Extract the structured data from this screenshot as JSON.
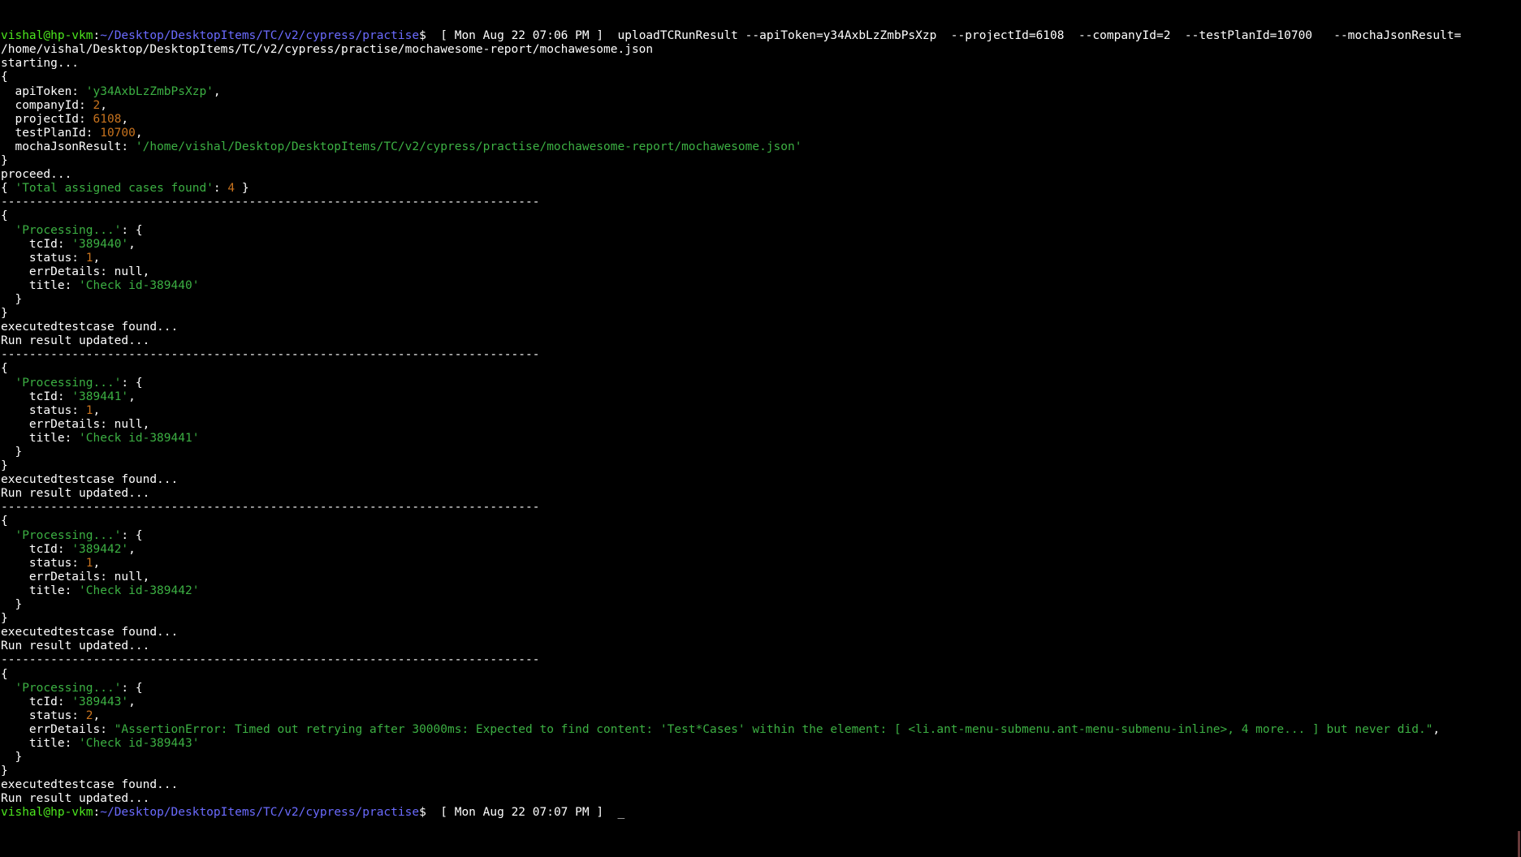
{
  "window": {
    "app": "Terminal",
    "colors": {
      "background": "#000000",
      "text": "#ffffff",
      "prompt_user": "#4ce61e",
      "prompt_path": "#6b6bff",
      "string": "#3cb043",
      "number": "#c8731e"
    }
  },
  "lines": [
    [
      {
        "t": "vishal@hp-vkm",
        "c": "green"
      },
      {
        "t": ":",
        "c": "white"
      },
      {
        "t": "~/Desktop/DesktopItems/TC/v2/cypress/practise",
        "c": "blue"
      },
      {
        "t": "$  [ Mon Aug 22 07:06 PM ]  uploadTCRunResult --apiToken=y34AxbLzZmbPsXzp  --projectId=6108  --companyId=2  --testPlanId=10700   --mochaJsonResult=",
        "c": "white"
      }
    ],
    [
      {
        "t": "/home/vishal/Desktop/DesktopItems/TC/v2/cypress/practise/mochawesome-report/mochawesome.json",
        "c": "white"
      }
    ],
    [
      {
        "t": "starting...",
        "c": "white"
      }
    ],
    [
      {
        "t": "{",
        "c": "white"
      }
    ],
    [
      {
        "t": "  apiToken: ",
        "c": "white"
      },
      {
        "t": "'y34AxbLzZmbPsXzp'",
        "c": "str"
      },
      {
        "t": ",",
        "c": "white"
      }
    ],
    [
      {
        "t": "  companyId: ",
        "c": "white"
      },
      {
        "t": "2",
        "c": "num"
      },
      {
        "t": ",",
        "c": "white"
      }
    ],
    [
      {
        "t": "  projectId: ",
        "c": "white"
      },
      {
        "t": "6108",
        "c": "num"
      },
      {
        "t": ",",
        "c": "white"
      }
    ],
    [
      {
        "t": "  testPlanId: ",
        "c": "white"
      },
      {
        "t": "10700",
        "c": "num"
      },
      {
        "t": ",",
        "c": "white"
      }
    ],
    [
      {
        "t": "  mochaJsonResult: ",
        "c": "white"
      },
      {
        "t": "'/home/vishal/Desktop/DesktopItems/TC/v2/cypress/practise/mochawesome-report/mochawesome.json'",
        "c": "str"
      }
    ],
    [
      {
        "t": "}",
        "c": "white"
      }
    ],
    [
      {
        "t": "proceed...",
        "c": "white"
      }
    ],
    [
      {
        "t": "{ ",
        "c": "white"
      },
      {
        "t": "'Total assigned cases found'",
        "c": "str"
      },
      {
        "t": ": ",
        "c": "white"
      },
      {
        "t": "4",
        "c": "num"
      },
      {
        "t": " }",
        "c": "white"
      }
    ],
    [
      {
        "t": "----------------------------------------------------------------------------",
        "c": "white"
      }
    ],
    [
      {
        "t": "{",
        "c": "white"
      }
    ],
    [
      {
        "t": "  ",
        "c": "white"
      },
      {
        "t": "'Processing...'",
        "c": "str"
      },
      {
        "t": ": {",
        "c": "white"
      }
    ],
    [
      {
        "t": "    tcId: ",
        "c": "white"
      },
      {
        "t": "'389440'",
        "c": "str"
      },
      {
        "t": ",",
        "c": "white"
      }
    ],
    [
      {
        "t": "    status: ",
        "c": "white"
      },
      {
        "t": "1",
        "c": "num"
      },
      {
        "t": ",",
        "c": "white"
      }
    ],
    [
      {
        "t": "    errDetails: null,",
        "c": "white"
      }
    ],
    [
      {
        "t": "    title: ",
        "c": "white"
      },
      {
        "t": "'Check id-389440'",
        "c": "str"
      }
    ],
    [
      {
        "t": "  }",
        "c": "white"
      }
    ],
    [
      {
        "t": "}",
        "c": "white"
      }
    ],
    [
      {
        "t": "executedtestcase found...",
        "c": "white"
      }
    ],
    [
      {
        "t": "Run result updated...",
        "c": "white"
      }
    ],
    [
      {
        "t": "----------------------------------------------------------------------------",
        "c": "white"
      }
    ],
    [
      {
        "t": "{",
        "c": "white"
      }
    ],
    [
      {
        "t": "  ",
        "c": "white"
      },
      {
        "t": "'Processing...'",
        "c": "str"
      },
      {
        "t": ": {",
        "c": "white"
      }
    ],
    [
      {
        "t": "    tcId: ",
        "c": "white"
      },
      {
        "t": "'389441'",
        "c": "str"
      },
      {
        "t": ",",
        "c": "white"
      }
    ],
    [
      {
        "t": "    status: ",
        "c": "white"
      },
      {
        "t": "1",
        "c": "num"
      },
      {
        "t": ",",
        "c": "white"
      }
    ],
    [
      {
        "t": "    errDetails: null,",
        "c": "white"
      }
    ],
    [
      {
        "t": "    title: ",
        "c": "white"
      },
      {
        "t": "'Check id-389441'",
        "c": "str"
      }
    ],
    [
      {
        "t": "  }",
        "c": "white"
      }
    ],
    [
      {
        "t": "}",
        "c": "white"
      }
    ],
    [
      {
        "t": "executedtestcase found...",
        "c": "white"
      }
    ],
    [
      {
        "t": "Run result updated...",
        "c": "white"
      }
    ],
    [
      {
        "t": "----------------------------------------------------------------------------",
        "c": "white"
      }
    ],
    [
      {
        "t": "{",
        "c": "white"
      }
    ],
    [
      {
        "t": "  ",
        "c": "white"
      },
      {
        "t": "'Processing...'",
        "c": "str"
      },
      {
        "t": ": {",
        "c": "white"
      }
    ],
    [
      {
        "t": "    tcId: ",
        "c": "white"
      },
      {
        "t": "'389442'",
        "c": "str"
      },
      {
        "t": ",",
        "c": "white"
      }
    ],
    [
      {
        "t": "    status: ",
        "c": "white"
      },
      {
        "t": "1",
        "c": "num"
      },
      {
        "t": ",",
        "c": "white"
      }
    ],
    [
      {
        "t": "    errDetails: null,",
        "c": "white"
      }
    ],
    [
      {
        "t": "    title: ",
        "c": "white"
      },
      {
        "t": "'Check id-389442'",
        "c": "str"
      }
    ],
    [
      {
        "t": "  }",
        "c": "white"
      }
    ],
    [
      {
        "t": "}",
        "c": "white"
      }
    ],
    [
      {
        "t": "executedtestcase found...",
        "c": "white"
      }
    ],
    [
      {
        "t": "Run result updated...",
        "c": "white"
      }
    ],
    [
      {
        "t": "----------------------------------------------------------------------------",
        "c": "white"
      }
    ],
    [
      {
        "t": "{",
        "c": "white"
      }
    ],
    [
      {
        "t": "  ",
        "c": "white"
      },
      {
        "t": "'Processing...'",
        "c": "str"
      },
      {
        "t": ": {",
        "c": "white"
      }
    ],
    [
      {
        "t": "    tcId: ",
        "c": "white"
      },
      {
        "t": "'389443'",
        "c": "str"
      },
      {
        "t": ",",
        "c": "white"
      }
    ],
    [
      {
        "t": "    status: ",
        "c": "white"
      },
      {
        "t": "2",
        "c": "num"
      },
      {
        "t": ",",
        "c": "white"
      }
    ],
    [
      {
        "t": "    errDetails: ",
        "c": "white"
      },
      {
        "t": "\"AssertionError: Timed out retrying after 30000ms: Expected to find content: 'Test*Cases' within the element: [ <li.ant-menu-submenu.ant-menu-submenu-inline>, 4 more... ] but never did.\"",
        "c": "str"
      },
      {
        "t": ",",
        "c": "white"
      }
    ],
    [
      {
        "t": "    title: ",
        "c": "white"
      },
      {
        "t": "'Check id-389443'",
        "c": "str"
      }
    ],
    [
      {
        "t": "  }",
        "c": "white"
      }
    ],
    [
      {
        "t": "}",
        "c": "white"
      }
    ],
    [
      {
        "t": "executedtestcase found...",
        "c": "white"
      }
    ],
    [
      {
        "t": "Run result updated...",
        "c": "white"
      }
    ],
    [
      {
        "t": "vishal@hp-vkm",
        "c": "green"
      },
      {
        "t": ":",
        "c": "white"
      },
      {
        "t": "~/Desktop/DesktopItems/TC/v2/cypress/practise",
        "c": "blue"
      },
      {
        "t": "$  [ Mon Aug 22 07:07 PM ]  ",
        "c": "white"
      }
    ]
  ],
  "cursor": {
    "glyph": "_",
    "icon": "block-cursor-icon"
  }
}
